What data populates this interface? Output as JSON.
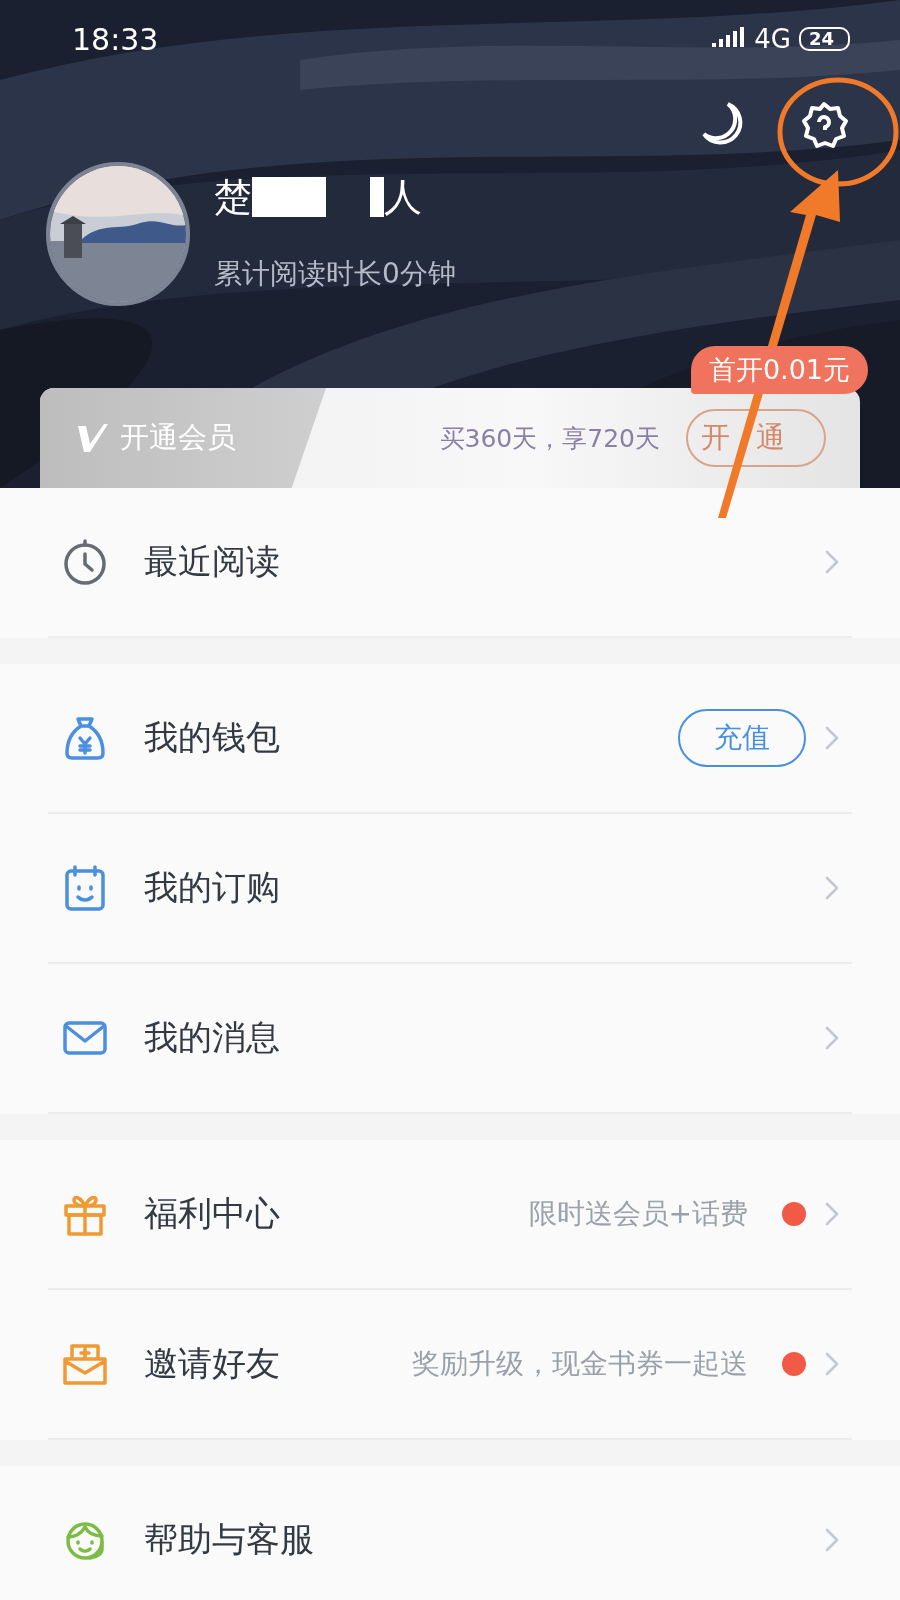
{
  "status_bar": {
    "time": "18:33",
    "network": "4G",
    "battery": "24"
  },
  "profile": {
    "name_parts": [
      "楚",
      "人"
    ],
    "reading_time": "累计阅读时长0分钟"
  },
  "vip": {
    "badge": "首开0.01元",
    "label": "开通会员",
    "offer": "买360天，享720天",
    "button": "开通"
  },
  "sections": [
    [
      {
        "label": "最近阅读"
      }
    ],
    [
      {
        "label": "我的钱包",
        "button": "充值"
      },
      {
        "label": "我的订购"
      },
      {
        "label": "我的消息"
      }
    ],
    [
      {
        "label": "福利中心",
        "hint": "限时送会员+话费",
        "unread": true
      },
      {
        "label": "邀请好友",
        "hint": "奖励升级，现金书券一起送",
        "unread": true
      }
    ],
    [
      {
        "label": "帮助与客服"
      }
    ]
  ]
}
